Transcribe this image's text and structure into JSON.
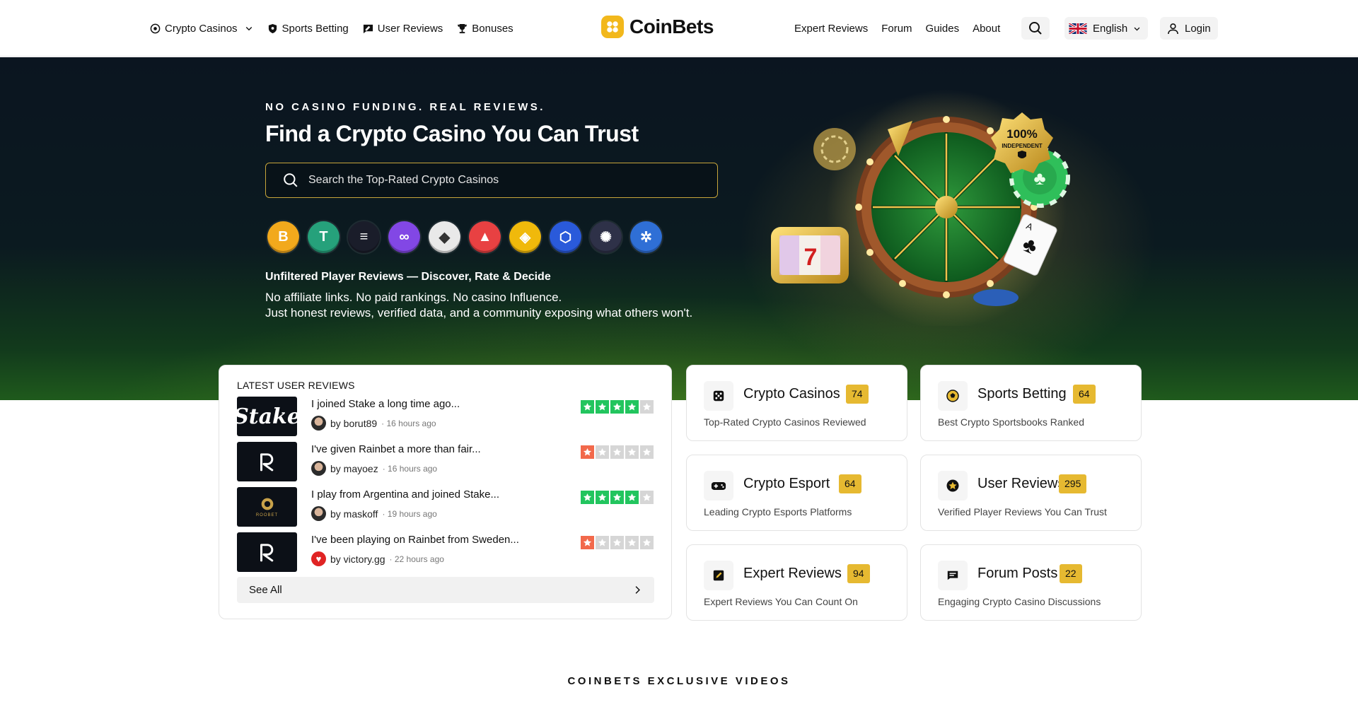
{
  "nav": {
    "left": [
      {
        "label": "Crypto Casinos",
        "icon": "casino-chip-icon",
        "has_dropdown": true
      },
      {
        "label": "Sports Betting",
        "icon": "shield-icon"
      },
      {
        "label": "User Reviews",
        "icon": "review-icon"
      },
      {
        "label": "Bonuses",
        "icon": "trophy-icon"
      }
    ],
    "brand": "CoinBets",
    "right": [
      {
        "label": "Expert Reviews"
      },
      {
        "label": "Forum"
      },
      {
        "label": "Guides"
      },
      {
        "label": "About"
      }
    ],
    "language": "English",
    "login": "Login"
  },
  "hero": {
    "eyebrow": "NO CASINO FUNDING. REAL REVIEWS.",
    "title": "Find a Crypto Casino You Can Trust",
    "search_placeholder": "Search the Top-Rated Crypto Casinos",
    "coins": [
      {
        "name": "bitcoin-icon",
        "glyph": "B",
        "color": "#f2a91c"
      },
      {
        "name": "tether-icon",
        "glyph": "T",
        "color": "#26a17b"
      },
      {
        "name": "solana-icon",
        "glyph": "≡",
        "color": "#1a1d2a"
      },
      {
        "name": "polygon-icon",
        "glyph": "∞",
        "color": "#8247e5"
      },
      {
        "name": "ethereum-icon",
        "glyph": "◆",
        "color": "#e9e9e9"
      },
      {
        "name": "avalanche-icon",
        "glyph": "▲",
        "color": "#e84142"
      },
      {
        "name": "bnb-icon",
        "glyph": "◈",
        "color": "#f0b90b"
      },
      {
        "name": "chainlink-icon",
        "glyph": "⬡",
        "color": "#2a5ada"
      },
      {
        "name": "cosmos-icon",
        "glyph": "✺",
        "color": "#2e3148"
      },
      {
        "name": "cardano-icon",
        "glyph": "✲",
        "color": "#2f6fd6"
      }
    ],
    "subtitle": "Unfiltered Player Reviews — Discover, Rate & Decide",
    "para1": "No affiliate links. No paid rankings. No casino Influence.",
    "para2": "Just honest reviews, verified data, and a community exposing what others won't.",
    "badge_text_1": "100%",
    "badge_text_2": "INDEPENDENT"
  },
  "latest_reviews": {
    "heading": "LATEST USER REVIEWS",
    "items": [
      {
        "brand": "Stake",
        "title": "I joined Stake a long time ago...",
        "author": "by borut89",
        "time": "· 16 hours ago",
        "rating": 4,
        "color": "#22c55e"
      },
      {
        "brand": "Rainbet",
        "title": "I've given Rainbet a more than fair...",
        "author": "by mayoez",
        "time": "· 16 hours ago",
        "rating": 1,
        "color": "#f2694b"
      },
      {
        "brand": "ROOBET",
        "title": "I play from Argentina and joined Stake...",
        "author": "by maskoff",
        "time": "· 19 hours ago",
        "rating": 4,
        "color": "#22c55e"
      },
      {
        "brand": "Rainbet",
        "title": "I've been playing on Rainbet from Sweden...",
        "author": "by victory.gg",
        "time": "· 22 hours ago",
        "rating": 1,
        "color": "#f2694b"
      }
    ],
    "see_all": "See All"
  },
  "categories": [
    {
      "title": "Crypto Casinos",
      "count": "74",
      "desc": "Top-Rated Crypto Casinos Reviewed",
      "icon": "dice-icon"
    },
    {
      "title": "Sports Betting",
      "count": "64",
      "desc": "Best Crypto Sportsbooks Ranked",
      "icon": "soccer-ball-icon"
    },
    {
      "title": "Crypto Esport",
      "count": "64",
      "desc": "Leading Crypto Esports Platforms",
      "icon": "gamepad-icon"
    },
    {
      "title": "User Reviews",
      "count": "295",
      "desc": "Verified Player Reviews You Can Trust",
      "icon": "star-badge-icon"
    },
    {
      "title": "Expert Reviews",
      "count": "94",
      "desc": "Expert Reviews You Can Count On",
      "icon": "edit-icon"
    },
    {
      "title": "Forum Posts",
      "count": "22",
      "desc": "Engaging Crypto Casino Discussions",
      "icon": "chat-icon"
    }
  ],
  "videos_heading": "COINBETS EXCLUSIVE VIDEOS"
}
